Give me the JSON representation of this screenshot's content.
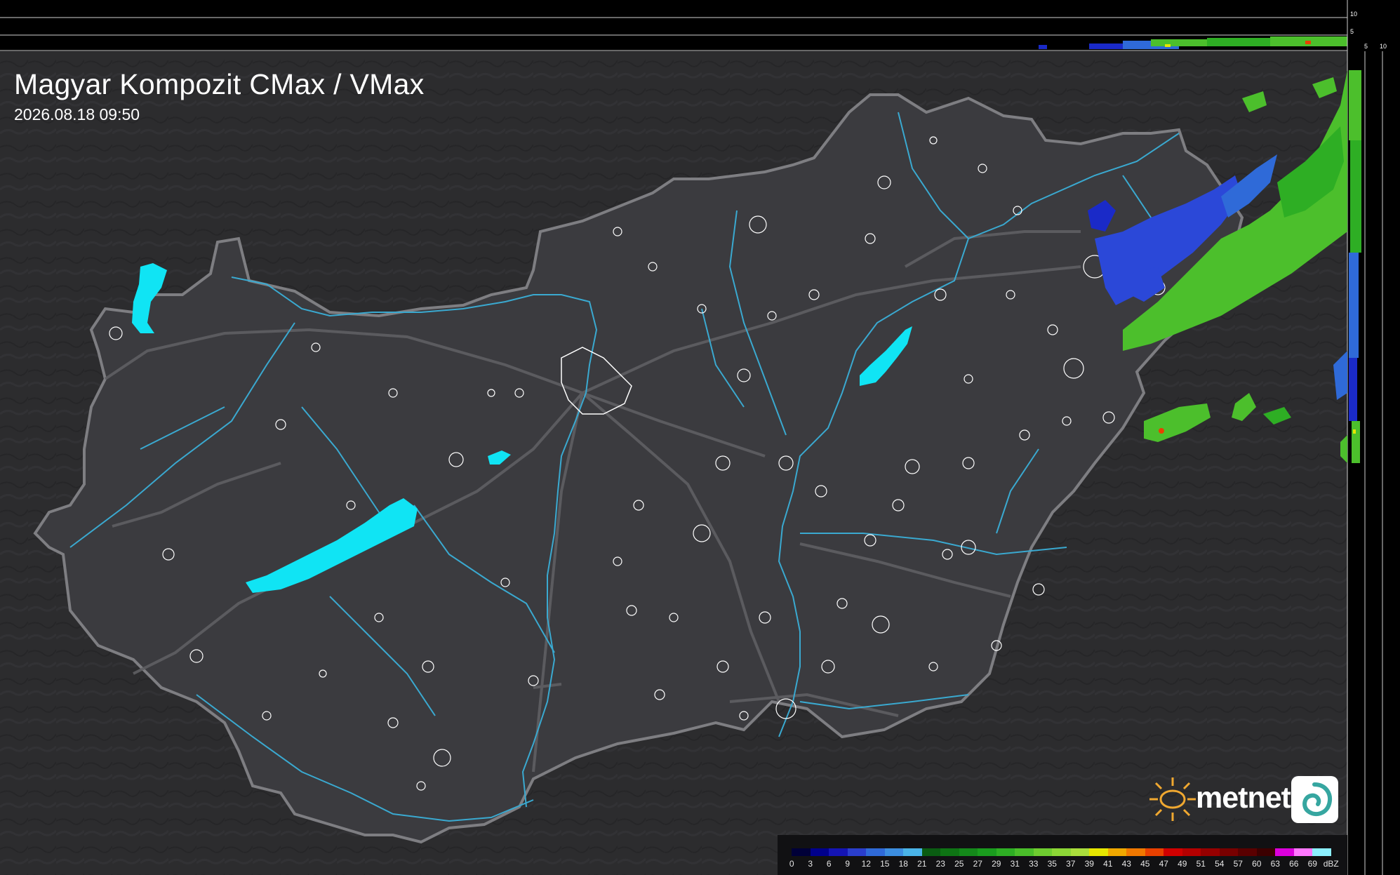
{
  "title": "Magyar Kompozit CMax / VMax",
  "timestamp": "2026.08.18 09:50",
  "brand": {
    "name": "metnet"
  },
  "legend": {
    "unit": "dBZ",
    "values": [
      "0",
      "3",
      "6",
      "9",
      "12",
      "15",
      "18",
      "21",
      "23",
      "25",
      "27",
      "29",
      "31",
      "33",
      "35",
      "37",
      "39",
      "41",
      "43",
      "45",
      "47",
      "49",
      "51",
      "54",
      "57",
      "60",
      "63",
      "66",
      "69"
    ],
    "colors": [
      "#000038",
      "#00008c",
      "#1414b4",
      "#2a3ecc",
      "#2f6ad8",
      "#3c8ee0",
      "#4ab4e8",
      "#0a5c12",
      "#0e7414",
      "#14881a",
      "#1a9c1e",
      "#2eae24",
      "#4abe2a",
      "#6ecc30",
      "#8cd636",
      "#aade3c",
      "#e6e600",
      "#f0a800",
      "#f07800",
      "#e84000",
      "#d00000",
      "#b40000",
      "#960000",
      "#780000",
      "#5a0000",
      "#3c0000",
      "#dc00dc",
      "#ff78ff",
      "#8cf0ff"
    ]
  },
  "side_axis": {
    "top_ticks": [
      "10",
      "5"
    ],
    "right_ticks": [
      "5",
      "10"
    ]
  },
  "colors": {
    "background": "#2c2c2e",
    "country": "#3b3b3f",
    "border": "#8a8a8e",
    "rivers": "#3aa9d0",
    "lakes": "#10e4f4",
    "city_outlines": "#ffffff",
    "echo_weak": "#2b48d8",
    "echo_mid": "#4cbf2c",
    "echo_strong": "#e6e600"
  }
}
